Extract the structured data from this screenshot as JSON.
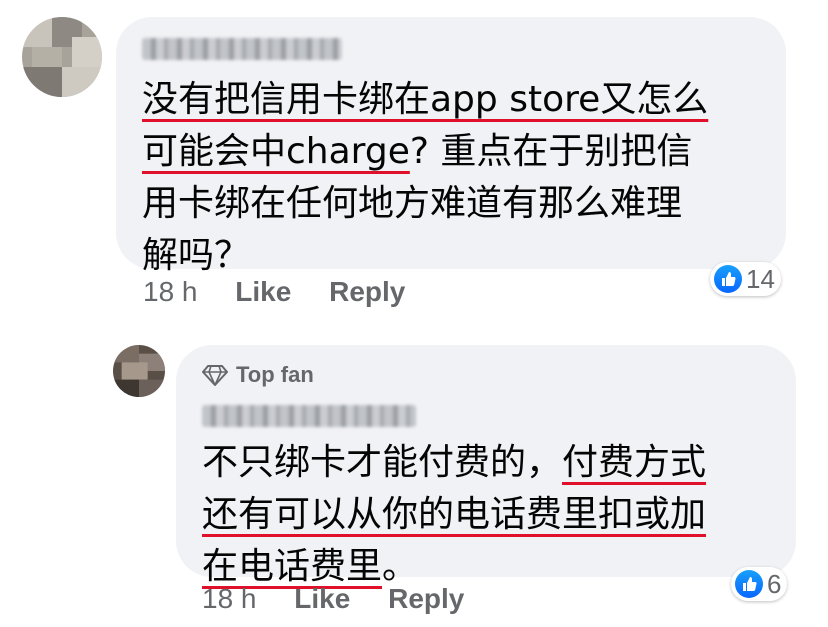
{
  "comments": [
    {
      "author_redacted": true,
      "lines": [
        [
          {
            "t": "没有把信用卡绑在app store又怎么",
            "u": true
          }
        ],
        [
          {
            "t": "可能会中charge",
            "u": true
          },
          {
            "t": "? 重点在于别把信",
            "u": false
          }
        ],
        [
          {
            "t": "用卡绑在任何地方难道有那么难理",
            "u": false
          }
        ],
        [
          {
            "t": "解吗？",
            "u": false
          }
        ]
      ],
      "time": "18 h",
      "like_label": "Like",
      "reply_label": "Reply",
      "reaction_count": "14",
      "reaction_icon": "thumbs-up-icon"
    },
    {
      "badge": "Top fan",
      "badge_icon": "diamond-icon",
      "author_redacted": true,
      "lines": [
        [
          {
            "t": "不只绑卡才能付费的，",
            "u": false
          },
          {
            "t": "付费方式",
            "u": true
          }
        ],
        [
          {
            "t": "还有可以从你的电话费里扣或加",
            "u": true
          }
        ],
        [
          {
            "t": "在电话费里",
            "u": true
          },
          {
            "t": "。",
            "u": false
          }
        ]
      ],
      "time": "18 h",
      "like_label": "Like",
      "reply_label": "Reply",
      "reaction_count": "6",
      "reaction_icon": "thumbs-up-icon"
    }
  ],
  "colors": {
    "bubble": "#f0f2f5",
    "underline": "#e0102a",
    "meta": "#65676b",
    "like_blue": "#0866ff"
  }
}
